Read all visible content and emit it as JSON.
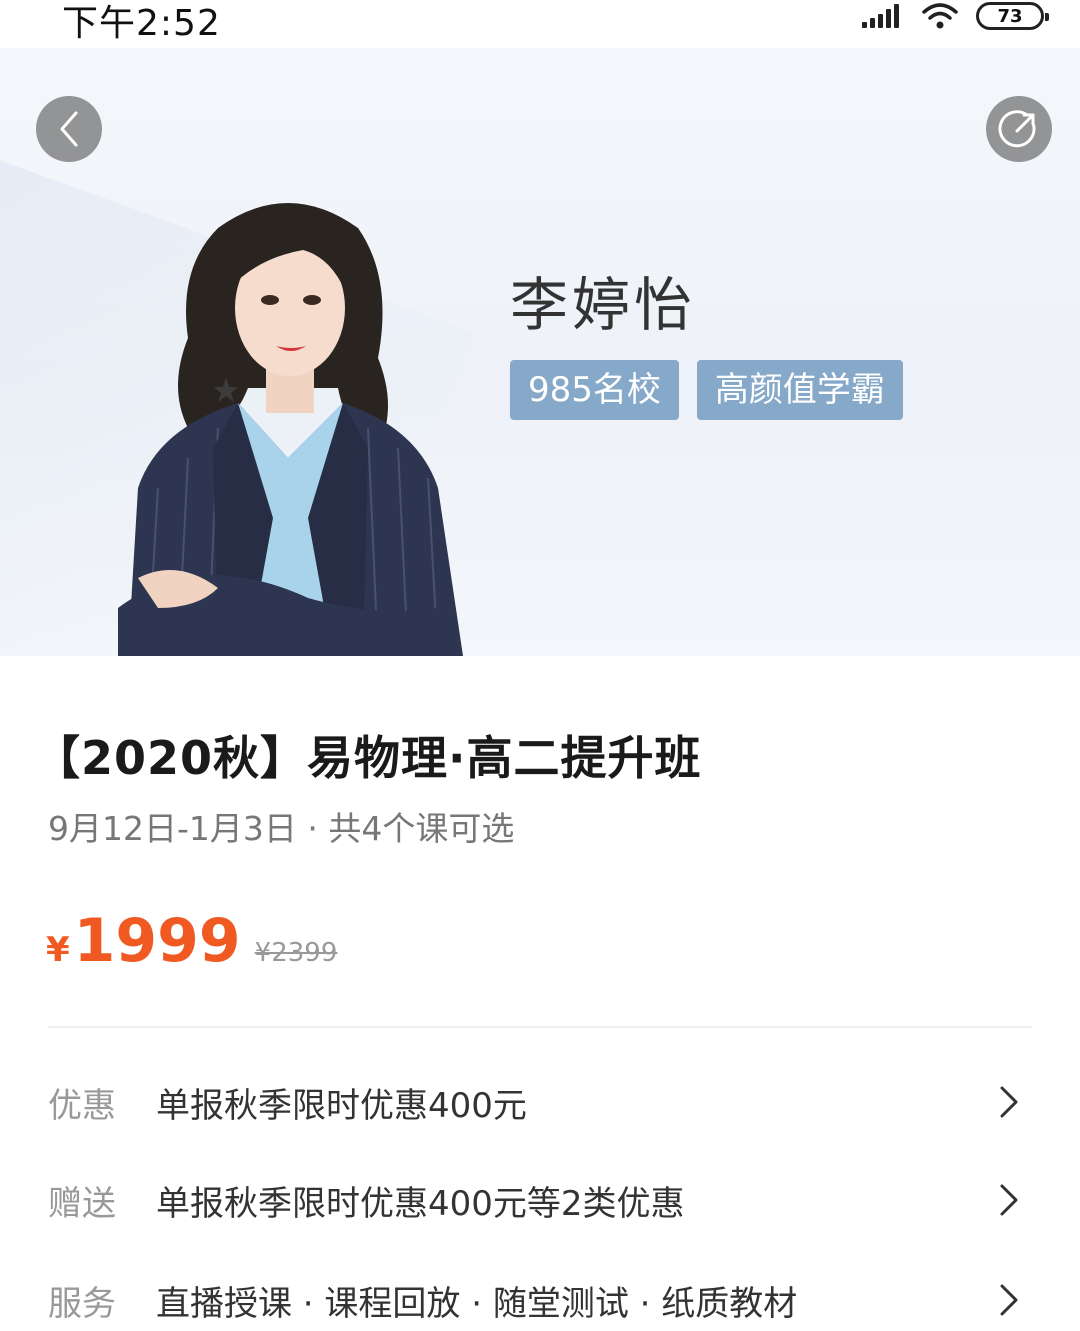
{
  "status_bar": {
    "time": "下午2:52",
    "battery": "73"
  },
  "hero": {
    "teacher_name": "李婷怡",
    "tags": [
      "985名校",
      "高颜值学霸"
    ],
    "tag_color": "#87a9c9"
  },
  "course": {
    "title": "【2020秋】易物理·高二提升班",
    "subtitle": "9月12日-1月3日 · 共4个课可选",
    "currency": "¥",
    "price": "1999",
    "original_price": "¥2399",
    "price_color": "#f05a22"
  },
  "info_rows": [
    {
      "label": "优惠",
      "text": "单报秋季限时优惠400元",
      "icon": "chevron-right-icon"
    },
    {
      "label": "赠送",
      "text": "单报秋季限时优惠400元等2类优惠",
      "icon": "chevron-right-icon"
    },
    {
      "label": "服务",
      "text": "直播授课 · 课程回放 · 随堂测试 · 纸质教材",
      "icon": "chevron-right-icon"
    }
  ]
}
